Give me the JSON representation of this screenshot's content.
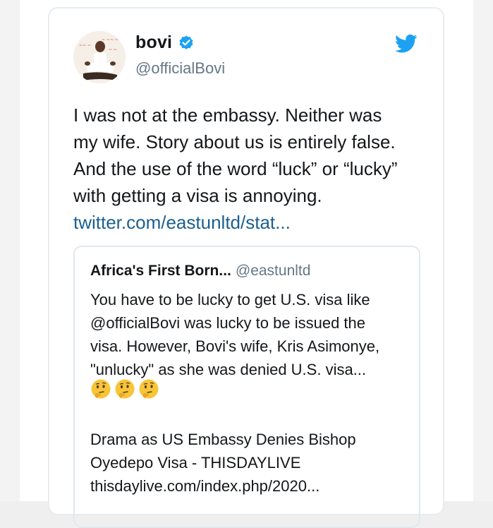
{
  "tweet": {
    "author_name": "bovi",
    "author_handle": "@officialBovi",
    "text_lines": [
      "I was not at the embassy. Neither was",
      "my wife. Story about us is entirely false.",
      "And the use of the word “luck” or “lucky”",
      "with getting a visa is annoying."
    ],
    "link": "twitter.com/eastunltd/stat...",
    "icons": {
      "avatar": "avatar-photo",
      "verified": "verified-badge-icon",
      "platform": "twitter-bird-icon"
    },
    "colors": {
      "verified": "#1da1f2",
      "bird": "#1da1f2",
      "link": "#1b5f8f"
    }
  },
  "quoted_tweet": {
    "author_name": "Africa's First Born...",
    "author_handle": "@eastunltd",
    "text_lines": [
      "You have to be lucky to get U.S. visa like",
      "@officialBovi was lucky to be issued the",
      "visa. However, Bovi's wife, Kris Asimonye,",
      "\"unlucky\" as she was denied U.S. visa..."
    ],
    "emojis": [
      "thinking-face-icon",
      "thinking-face-icon",
      "thinking-face-icon"
    ],
    "card": {
      "title_lines": [
        "Drama as US Embassy Denies Bishop",
        "Oyedepo Visa - THISDAYLIVE"
      ],
      "url": "thisdaylive.com/index.php/2020..."
    }
  }
}
